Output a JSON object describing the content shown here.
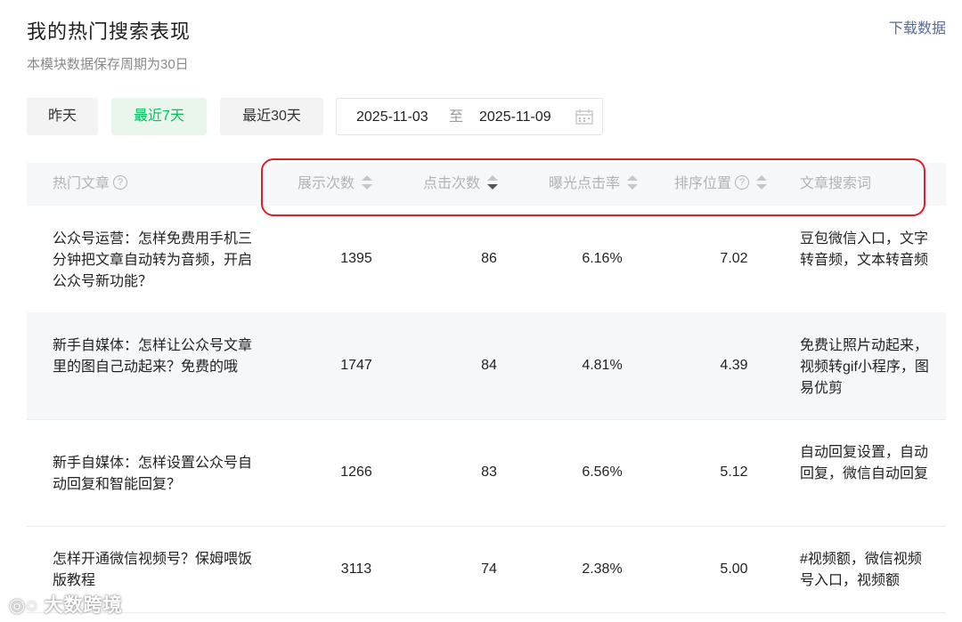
{
  "header": {
    "title": "我的热门搜索表现",
    "subtitle": "本模块数据保存周期为30日",
    "download_label": "下载数据"
  },
  "filters": {
    "tabs": [
      {
        "label": "昨天",
        "active": false
      },
      {
        "label": "最近7天",
        "active": true
      },
      {
        "label": "最近30天",
        "active": false
      }
    ],
    "date_start": "2025-11-03",
    "date_sep": "至",
    "date_end": "2025-11-09"
  },
  "table": {
    "columns": [
      "热门文章",
      "展示次数",
      "点击次数",
      "曝光点击率",
      "排序位置",
      "文章搜索词"
    ],
    "sorted_column": "点击次数",
    "sort_direction": "desc",
    "rows": [
      {
        "title": "公众号运营：怎样免费用手机三分钟把文章自动转为音频，开启公众号新功能？",
        "impressions": "1395",
        "clicks": "86",
        "ctr": "6.16%",
        "position": "7.02",
        "keywords": "豆包微信入口，文字转音频，文本转音频"
      },
      {
        "title": "新手自媒体：怎样让公众号文章里的图自己动起来？免费的哦",
        "impressions": "1747",
        "clicks": "84",
        "ctr": "4.81%",
        "position": "4.39",
        "keywords": "免费让照片动起来，视频转gif小程序，图易优剪"
      },
      {
        "title": "新手自媒体：怎样设置公众号自动回复和智能回复？",
        "impressions": "1266",
        "clicks": "83",
        "ctr": "6.56%",
        "position": "5.12",
        "keywords": "自动回复设置，自动回复，微信自动回复"
      },
      {
        "title": "怎样开通微信视频号？保姆喂饭版教程",
        "impressions": "3113",
        "clicks": "74",
        "ctr": "2.38%",
        "position": "5.00",
        "keywords": "#视频额，微信视频号入口，视频额"
      }
    ]
  },
  "colors": {
    "accent_green": "#07c160",
    "link_blue": "#576b95",
    "highlight_red": "#d8222b"
  },
  "watermark": "大数跨境"
}
